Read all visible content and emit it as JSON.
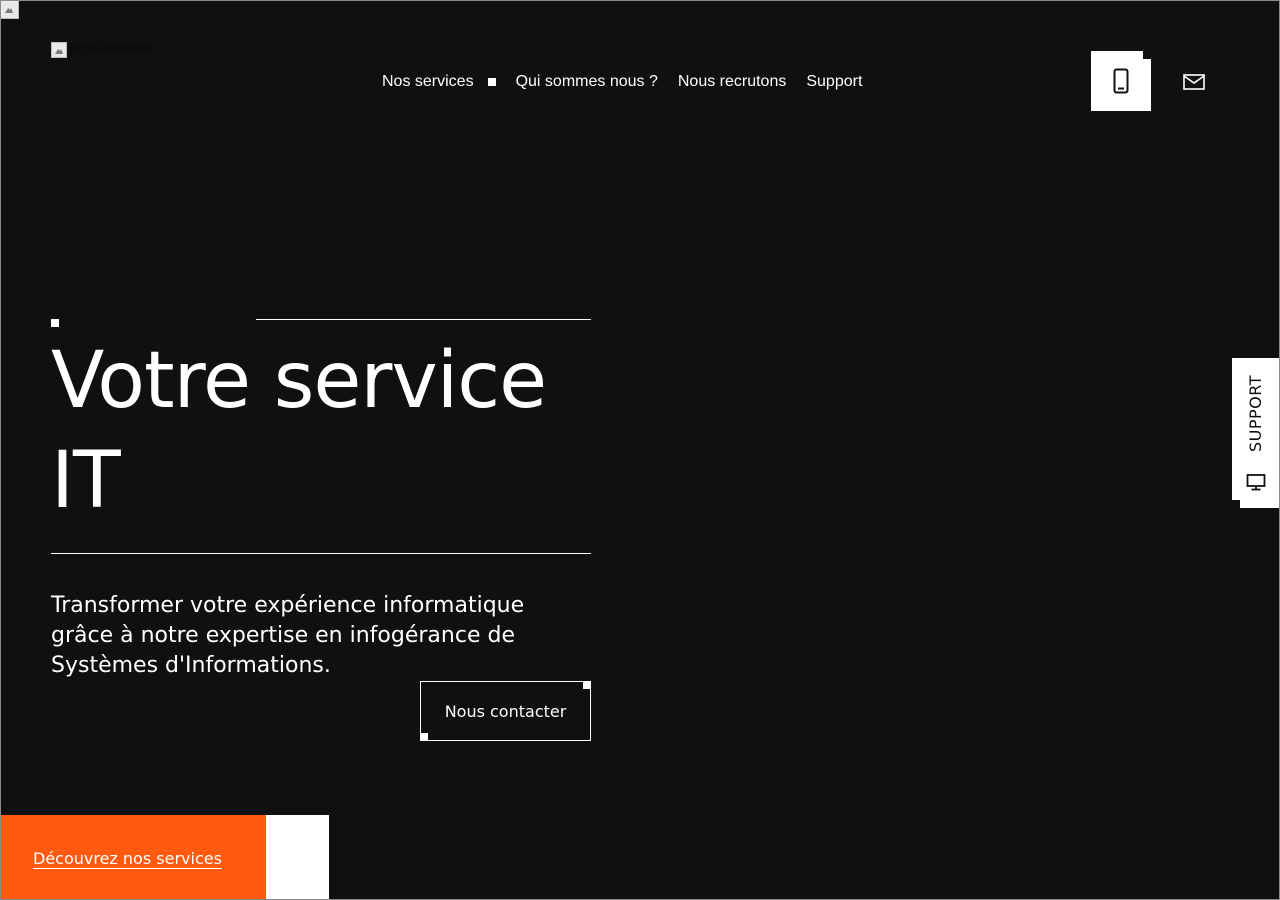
{
  "logo": {
    "alt": "logo-tekinova"
  },
  "nav": {
    "items": [
      {
        "label": "Nos services"
      },
      {
        "label": "Qui sommes nous ?"
      },
      {
        "label": "Nous recrutons"
      },
      {
        "label": "Support"
      }
    ]
  },
  "contact_icons": {
    "phone": "smartphone-icon",
    "mail": "envelope-icon"
  },
  "hero": {
    "title": "Votre service IT",
    "subtitle": "Transformer votre expérience informatique grâce à notre expertise en infogérance de Systèmes d'Informations.",
    "cta_label": "Nous contacter"
  },
  "bottom_cta": {
    "label": "Découvrez nos services"
  },
  "support_tab": {
    "label": "SUPPORT",
    "icon": "monitor-icon"
  },
  "colors": {
    "background": "#101010",
    "accent": "#ff5a0f",
    "text": "#ffffff"
  }
}
